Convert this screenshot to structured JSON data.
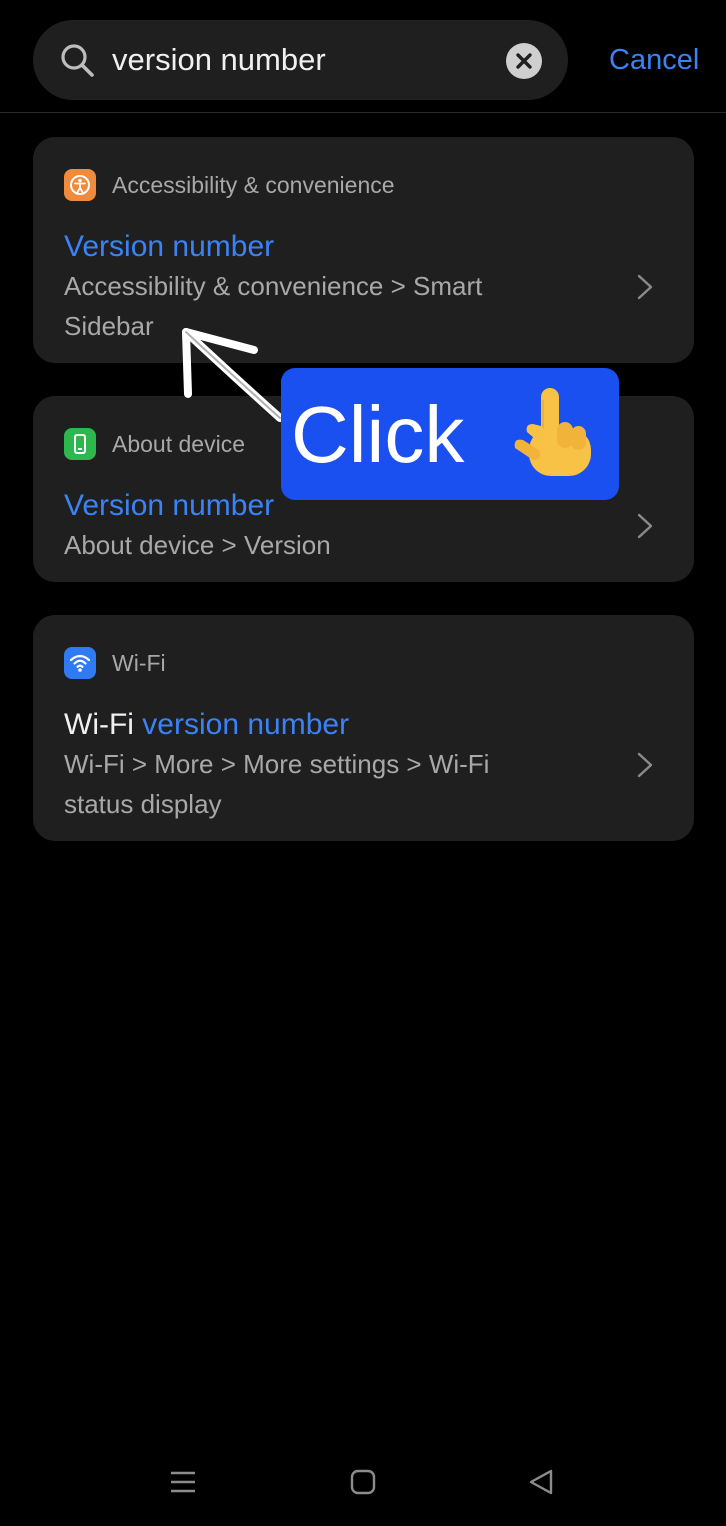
{
  "search": {
    "query": "version number",
    "cancel_label": "Cancel"
  },
  "results": [
    {
      "category": "Accessibility & convenience",
      "category_icon": "accessibility-icon",
      "category_color": "#f08a3c",
      "title_plain": "",
      "title_highlight": "Version number",
      "path": "Accessibility & convenience > Smart Sidebar"
    },
    {
      "category": "About device",
      "category_icon": "device-icon",
      "category_color": "#2db84d",
      "title_plain": "",
      "title_highlight": "Version number",
      "path": "About device > Version"
    },
    {
      "category": "Wi-Fi",
      "category_icon": "wifi-icon",
      "category_color": "#2f7bf5",
      "title_plain": "Wi-Fi ",
      "title_highlight": "version number",
      "path": "Wi-Fi > More > More settings > Wi-Fi status display"
    }
  ],
  "annotation": {
    "label": "Click",
    "hand_icon": "pointing-hand-icon",
    "badge_color": "#1a4ff0"
  },
  "navbar": {
    "icons": [
      "menu-icon",
      "home-icon",
      "back-icon"
    ]
  },
  "colors": {
    "accent": "#3b82f6",
    "card_bg": "#1f1f1f",
    "background": "#000000"
  }
}
